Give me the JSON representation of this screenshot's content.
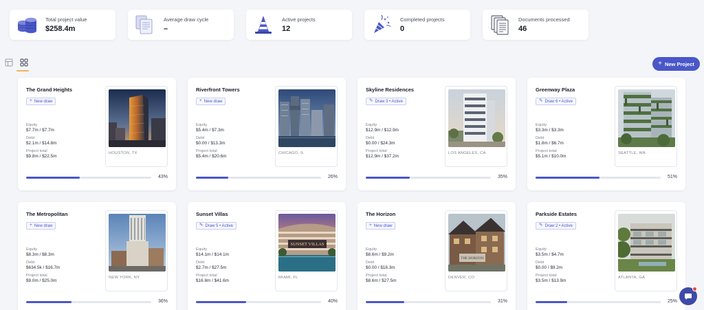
{
  "stats": [
    {
      "label": "Total project value",
      "value": "$258.4m",
      "icon": "coins-stack-icon"
    },
    {
      "label": "Average draw cycle",
      "value": "–",
      "icon": "documents-icon"
    },
    {
      "label": "Active projects",
      "value": "12",
      "icon": "traffic-cone-icon"
    },
    {
      "label": "Completed projects",
      "value": "0",
      "icon": "party-popper-icon"
    },
    {
      "label": "Documents processed",
      "value": "46",
      "icon": "document-stack-icon"
    }
  ],
  "toolbar": {
    "list_view_icon": "table-view-icon",
    "grid_view_icon": "grid-view-icon",
    "new_project_label": "New Project"
  },
  "field_labels": {
    "equity": "Equity",
    "debt": "Debt",
    "project_total": "Project total"
  },
  "projects": [
    {
      "name": "The Grand Heights",
      "badge": "New draw",
      "badge_type": "new",
      "equity": "$7.7m / $7.7m",
      "debt": "$2.1m / $14.8m",
      "total": "$9.8m / $22.5m",
      "city": "HOUSTON, TX",
      "progress": 43,
      "progress_label": "43%"
    },
    {
      "name": "Riverfront Towers",
      "badge": "New draw",
      "badge_type": "new",
      "equity": "$5.4m / $7.3m",
      "debt": "$0.00 / $13.3m",
      "total": "$5.4m / $20.6m",
      "city": "CHICAGO, IL",
      "progress": 26,
      "progress_label": "26%"
    },
    {
      "name": "Skyline Residences",
      "badge": "Draw 3 • Active",
      "badge_type": "active",
      "equity": "$12.9m / $12.9m",
      "debt": "$0.00 / $24.3m",
      "total": "$12.9m / $37.2m",
      "city": "LOS ANGELES, CA",
      "progress": 35,
      "progress_label": "35%"
    },
    {
      "name": "Greenway Plaza",
      "badge": "Draw 6 • Active",
      "badge_type": "active",
      "equity": "$3.3m / $3.3m",
      "debt": "$1.8m / $6.7m",
      "total": "$5.1m / $10.0m",
      "city": "SEATTLE, WA",
      "progress": 51,
      "progress_label": "51%"
    },
    {
      "name": "The Metropolitan",
      "badge": "New draw",
      "badge_type": "new",
      "equity": "$8.3m / $8.3m",
      "debt": "$634.5k / $16.7m",
      "total": "$9.0m / $25.0m",
      "city": "NEW YORK, NY",
      "progress": 36,
      "progress_label": "36%"
    },
    {
      "name": "Sunset Villas",
      "badge": "Draw 5 • Active",
      "badge_type": "active",
      "equity": "$14.1m / $14.1m",
      "debt": "$2.7m / $27.5m",
      "total": "$16.8m / $41.6m",
      "city": "MIAMI, FL",
      "progress": 40,
      "progress_label": "40%",
      "sign": "SUNSET VILLAS"
    },
    {
      "name": "The Horizon",
      "badge": "New draw",
      "badge_type": "new",
      "equity": "$8.6m / $9.2m",
      "debt": "$0.00 / $18.3m",
      "total": "$8.6m / $27.5m",
      "city": "DENVER, CO",
      "progress": 31,
      "progress_label": "31%",
      "sign": "THE HORIZON"
    },
    {
      "name": "Parkside Estates",
      "badge": "Draw 2 • Active",
      "badge_type": "active",
      "equity": "$3.5m / $4.7m",
      "debt": "$0.00 / $9.2m",
      "total": "$3.5m / $13.9m",
      "city": "ATLANTA, GA",
      "progress": 25,
      "progress_label": "25%"
    }
  ],
  "colors": {
    "accent": "#4a57c9",
    "background": "#f4f5f8",
    "tab_underline": "#f0b35a"
  },
  "chat": {
    "icon": "chat-bubble-icon",
    "has_notification": true
  }
}
